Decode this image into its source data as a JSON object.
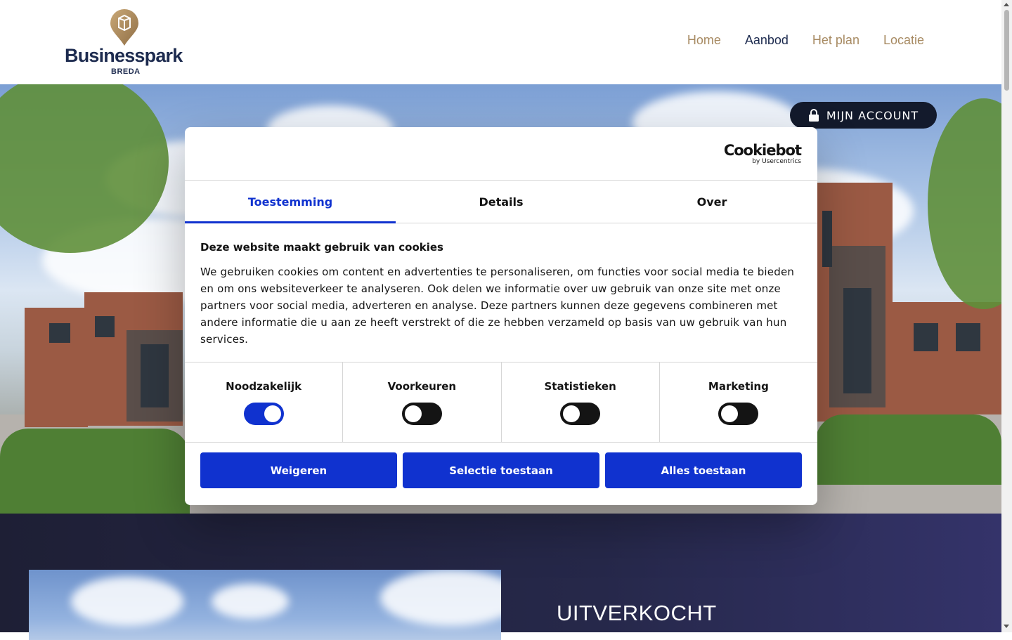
{
  "header": {
    "logo": {
      "name": "Businesspark",
      "sub": "BREDA"
    },
    "nav": [
      {
        "label": "Home",
        "active": false
      },
      {
        "label": "Aanbod",
        "active": true
      },
      {
        "label": "Het plan",
        "active": false
      },
      {
        "label": "Locatie",
        "active": false
      }
    ]
  },
  "hero": {
    "account_button": "MIJN ACCOUNT"
  },
  "section": {
    "title": "UITVERKOCHT"
  },
  "cookie_dialog": {
    "brand": {
      "name": "Cookiebot",
      "sub": "by Usercentrics"
    },
    "tabs": [
      {
        "label": "Toestemming",
        "active": true
      },
      {
        "label": "Details",
        "active": false
      },
      {
        "label": "Over",
        "active": false
      }
    ],
    "heading": "Deze website maakt gebruik van cookies",
    "text": "We gebruiken cookies om content en advertenties te personaliseren, om functies voor social media te bieden en om ons websiteverkeer te analyseren. Ook delen we informatie over uw gebruik van onze site met onze partners voor social media, adverteren en analyse. Deze partners kunnen deze gegevens combineren met andere informatie die u aan ze heeft verstrekt of die ze hebben verzameld op basis van uw gebruik van hun services.",
    "toggles": [
      {
        "label": "Noodzakelijk",
        "on": true
      },
      {
        "label": "Voorkeuren",
        "on": false
      },
      {
        "label": "Statistieken",
        "on": false
      },
      {
        "label": "Marketing",
        "on": false
      }
    ],
    "buttons": {
      "decline": "Weigeren",
      "selection": "Selectie toestaan",
      "allow_all": "Alles toestaan"
    }
  },
  "colors": {
    "primary_blue": "#1032cf",
    "navy": "#1d2b4f",
    "gold": "#a78a62",
    "account_btn": "#131a2c"
  }
}
